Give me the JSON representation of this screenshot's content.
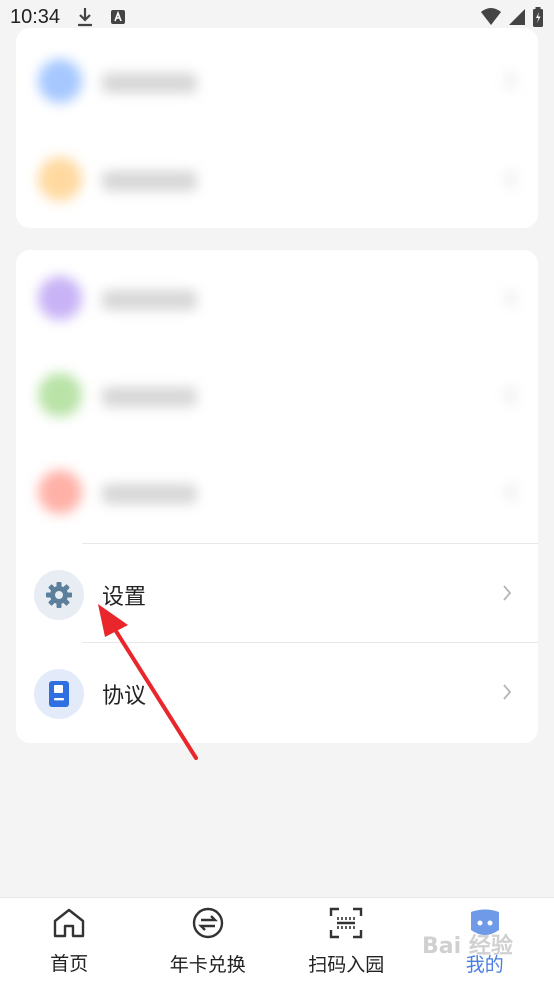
{
  "status_bar": {
    "time": "10:34",
    "icons": [
      "download-icon",
      "text-notification-icon",
      "wifi-icon",
      "signal-icon",
      "battery-icon"
    ]
  },
  "menu": {
    "items": [
      {
        "label": "设置",
        "icon": "gear-icon",
        "icon_bg": "#e7edf3",
        "icon_color": "#5c7f9b"
      },
      {
        "label": "协议",
        "icon": "document-icon",
        "icon_bg": "#e3ebfb",
        "icon_color": "#2f6fe0"
      }
    ]
  },
  "blurred_items": [
    {
      "icon_color": "#a6c8ff"
    },
    {
      "icon_color": "#ffd9a0"
    },
    {
      "icon_color": "#c8b3f6"
    },
    {
      "icon_color": "#b9e3a7"
    },
    {
      "icon_color": "#ffb1a7"
    }
  ],
  "tabbar": {
    "tabs": [
      {
        "label": "首页",
        "icon": "home-icon"
      },
      {
        "label": "年卡兑换",
        "icon": "exchange-icon"
      },
      {
        "label": "扫码入园",
        "icon": "scan-icon"
      },
      {
        "label": "我的",
        "icon": "profile-icon",
        "active": true
      }
    ]
  },
  "watermark": "Bai 经验",
  "colors": {
    "accent": "#4a7ee3",
    "arrow": "#e8262b"
  }
}
